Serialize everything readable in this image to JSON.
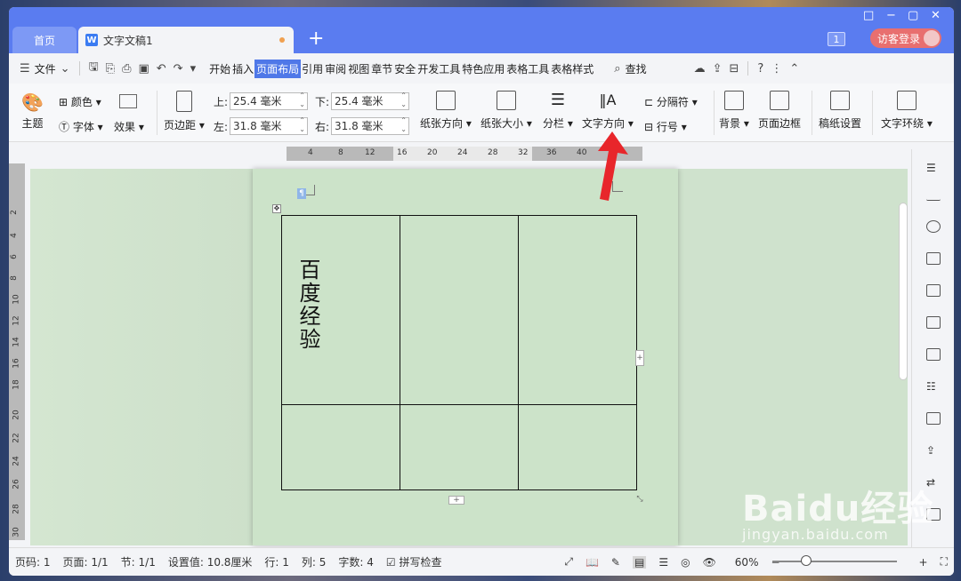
{
  "tabs": {
    "home": "首页",
    "doc": "文字文稿1",
    "doc_icon": "W",
    "add": "+"
  },
  "window_controls": [
    "□",
    "−",
    "▢",
    "✕"
  ],
  "titlebar": {
    "badge": "1",
    "login": "访客登录"
  },
  "menubar": {
    "file": "文件",
    "items": [
      "开始",
      "插入",
      "页面布局",
      "引用",
      "审阅",
      "视图",
      "章节",
      "安全",
      "开发工具",
      "特色应用",
      "表格工具",
      "表格样式"
    ],
    "active": "页面布局",
    "search": "查找"
  },
  "ribbon": {
    "theme": "主题",
    "color": "颜色",
    "font": "字体",
    "effect": "效果",
    "margin": "页边距",
    "top_label": "上:",
    "top_value": "25.4 毫米",
    "bottom_label": "下:",
    "bottom_value": "25.4 毫米",
    "left_label": "左:",
    "left_value": "31.8 毫米",
    "right_label": "右:",
    "right_value": "31.8 毫米",
    "orientation": "纸张方向",
    "size": "纸张大小",
    "columns": "分栏",
    "text_direction": "文字方向",
    "separator": "分隔符",
    "line_number": "行号",
    "background": "背景",
    "page_border": "页面边框",
    "manuscript": "稿纸设置",
    "text_wrap": "文字环绕"
  },
  "ruler": {
    "h_ticks": [
      "4",
      "8",
      "12",
      "16",
      "20",
      "24",
      "28",
      "32",
      "36",
      "40"
    ],
    "v_ticks": [
      "2",
      "4",
      "6",
      "8",
      "10",
      "12",
      "14",
      "16",
      "18",
      "20",
      "22",
      "24",
      "26",
      "28",
      "30"
    ]
  },
  "document": {
    "cell_text": "百度经验"
  },
  "statusbar": {
    "page_num": "页码: 1",
    "pages": "页面: 1/1",
    "section": "节: 1/1",
    "setting": "设置值: 10.8厘米",
    "row": "行: 1",
    "col": "列: 5",
    "words": "字数: 4",
    "spell": "拼写检查",
    "zoom": "60%"
  },
  "watermark": {
    "brand": "Baidu经验",
    "url": "jingyan.baidu.com"
  },
  "colors": {
    "tabbar": "#5a7cf0",
    "active_menu": "#4f78e8",
    "doc_bg": "#cce3c9",
    "arrow": "#e8262b",
    "login": "#e86f6f"
  }
}
